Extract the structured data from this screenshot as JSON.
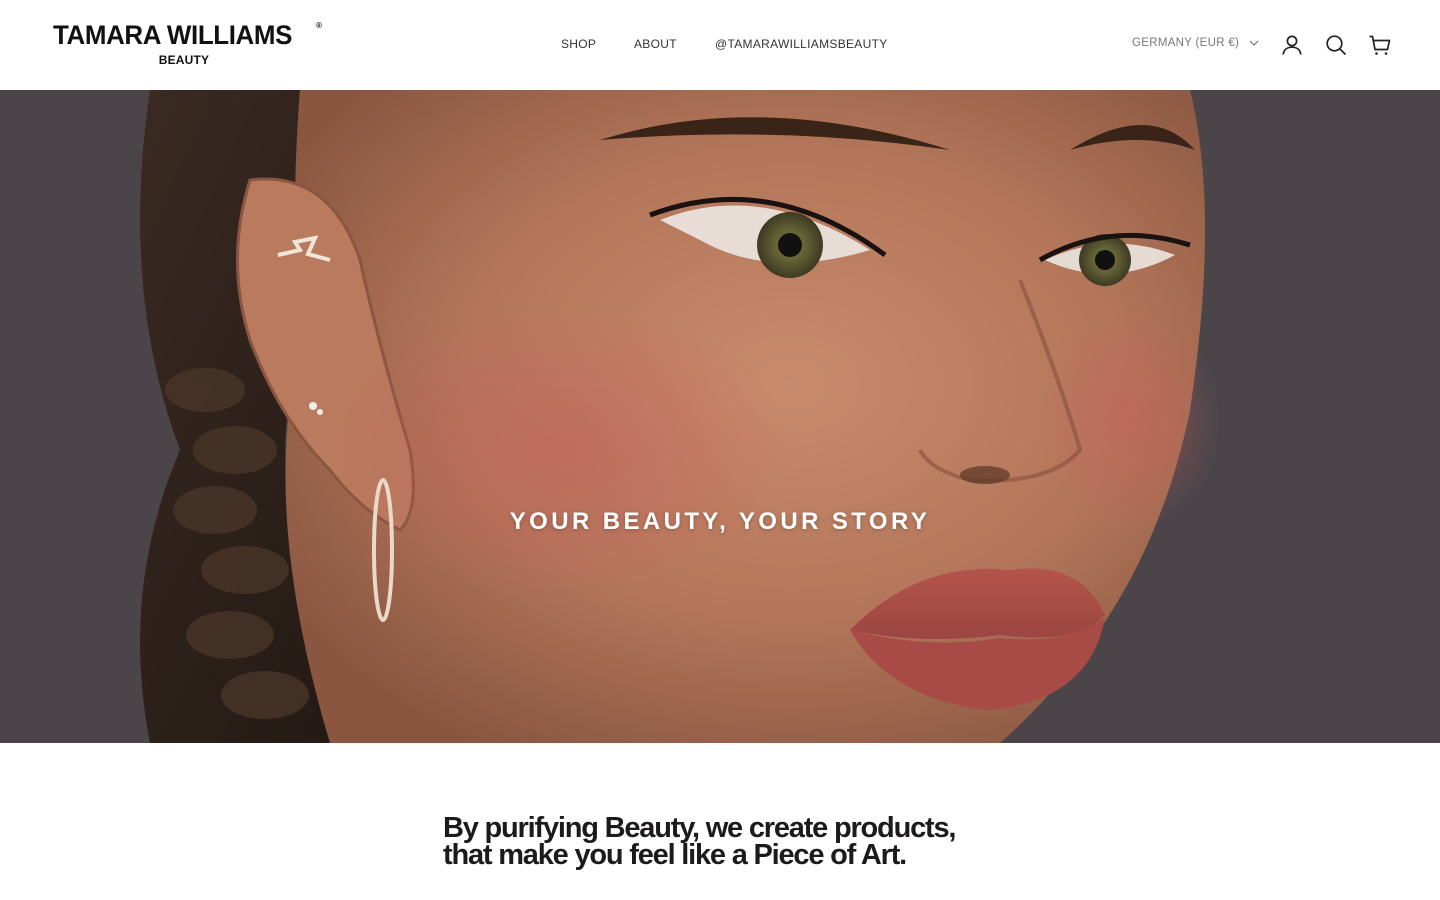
{
  "brand": {
    "name": "TAMARA WILLIAMS",
    "registered": "®",
    "sub": "BEAUTY"
  },
  "nav": {
    "items": [
      {
        "label": "SHOP"
      },
      {
        "label": "ABOUT"
      },
      {
        "label": "@TAMARAWILLIAMSBEAUTY"
      }
    ]
  },
  "header": {
    "region": "GERMANY (EUR €)",
    "icons": [
      "account-icon",
      "search-icon",
      "cart-icon"
    ]
  },
  "hero": {
    "title": "YOUR BEAUTY, YOUR STORY",
    "background_color": "#4a4448"
  },
  "statement": {
    "line1": "By purifying Beauty, we create products,",
    "line2": "that make you feel like a Piece of Art."
  },
  "colors": {
    "text": "#1c1c1c",
    "muted": "#777777",
    "background": "#ffffff"
  }
}
